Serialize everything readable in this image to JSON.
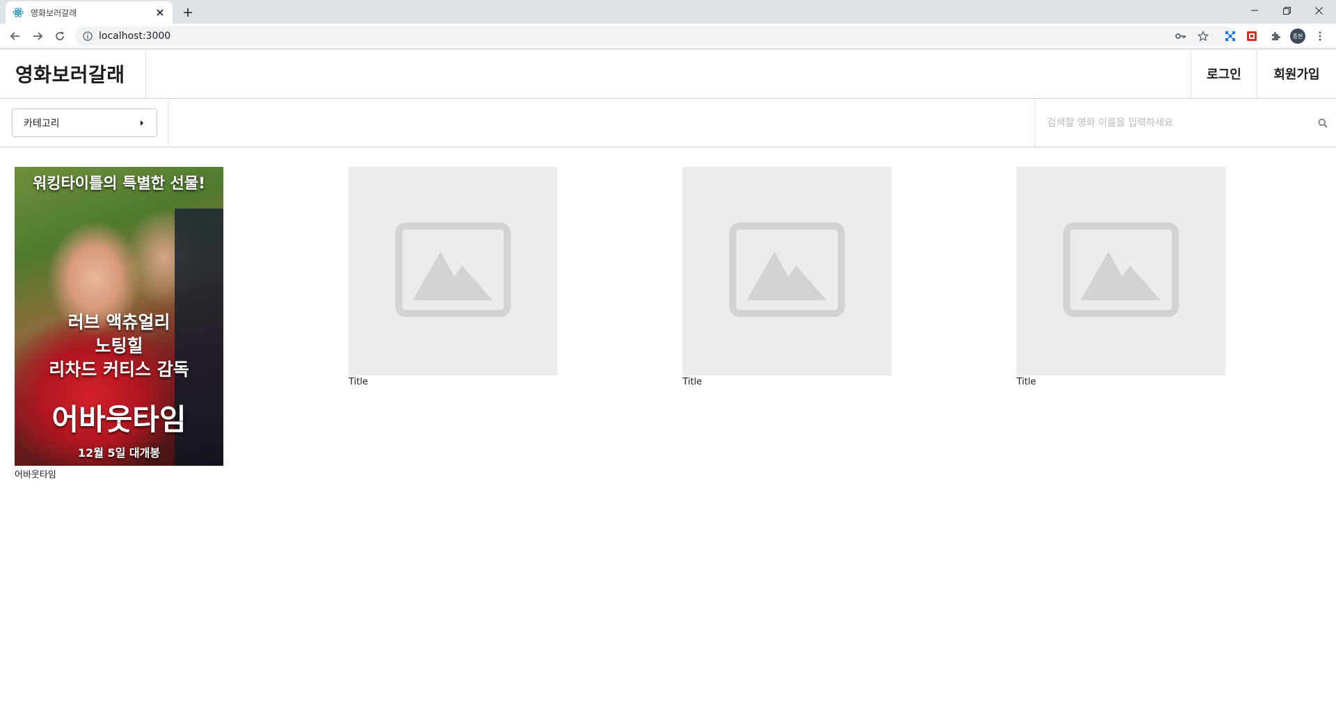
{
  "browser": {
    "tab_title": "영화보러갈래",
    "url": "localhost:3000",
    "profile_initials": "종현"
  },
  "header": {
    "brand": "영화보러갈래",
    "login": "로그인",
    "signup": "회원가입"
  },
  "subbar": {
    "category_label": "카테고리",
    "search_placeholder": "검색할 영화 이름을 입력하세요"
  },
  "movies": [
    {
      "title": "어바웃타임",
      "poster": {
        "tagline": "워킹타이틀의 특별한 선물!",
        "credit_line_1": "러브 액츄얼리",
        "credit_line_2": "노팅힐",
        "credit_line_3": "리차드 커티스 감독",
        "poster_title": "어바웃타임",
        "release": "12월 5일 대개봉"
      }
    },
    {
      "title": "Title"
    },
    {
      "title": "Title"
    },
    {
      "title": "Title"
    }
  ],
  "colors": {
    "placeholder_bg": "#ececec",
    "placeholder_icon": "#d3d3d3",
    "chrome_bg": "#dee1e6"
  }
}
